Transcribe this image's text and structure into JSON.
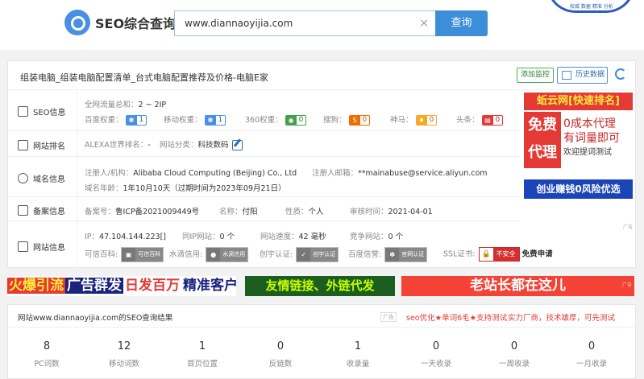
{
  "header": {
    "logo_text": "SEO综合查询",
    "search_value": "www.diannaoyijia.com",
    "search_button": "查询",
    "clear_glyph": "×",
    "corner_text": "权威 数据 精准 分析"
  },
  "site": {
    "title": "组装电脑_组装电脑配置清单_台式电脑配置推荐及价格-电脑E家",
    "monitor_button": "添加监控",
    "history_button": "历史数据"
  },
  "seo": {
    "label": "SEO信息",
    "traffic_label": "全网流量总和：",
    "traffic_value": "2 ~ 2IP",
    "weights": [
      {
        "label": "百度权重：",
        "value": "1",
        "color": "#4a90e2"
      },
      {
        "label": "移动权重：",
        "value": "1",
        "color": "#4a90e2"
      },
      {
        "label": "360权重：",
        "value": "0",
        "color": "#43a047"
      },
      {
        "label": "搜狗：",
        "value": "0",
        "color": "#ef6c00"
      },
      {
        "label": "神马：",
        "value": "0",
        "color": "#f9a825"
      },
      {
        "label": "头条：",
        "value": "0",
        "color": "#e53935"
      }
    ]
  },
  "rank": {
    "label": "网站排名",
    "alexa_label": "ALEXA世界排名：",
    "alexa_value": "-",
    "category_label": "网站分类：",
    "category_value": "科技数码"
  },
  "domain": {
    "label": "域名信息",
    "registrant_label": "注册人/机构：",
    "registrant_value": "Alibaba Cloud Computing (Beijing) Co., Ltd",
    "email_label": "注册人邮箱：",
    "email_value": "**mainabuse@service.aliyun.com",
    "age_label": "域名年龄：",
    "age_value": "1年10月10天（过期时间为2023年09月21日）"
  },
  "icp": {
    "label": "备案信息",
    "number_label": "备案号：",
    "number_value": "鲁ICP备2021009449号",
    "name_label": "名称：",
    "name_value": "付阳",
    "nature_label": "性质：",
    "nature_value": "个人",
    "date_label": "审核时间：",
    "date_value": "2021-04-01"
  },
  "siteinfo": {
    "label": "网站信息",
    "ip_label": "IP：",
    "ip_value": "47.104.144.223[]",
    "sameip_label": "同IP网站：",
    "sameip_value": "0 个",
    "speed_label": "网站速度：",
    "speed_value": "42 毫秒",
    "competitor_label": "竞争网站：",
    "competitor_value": "0 个",
    "certs": [
      {
        "label": "可信百科:",
        "badge": "可信百科"
      },
      {
        "label": "水滴信用:",
        "badge": "水滴信用"
      },
      {
        "label": "创宇认证:",
        "badge": "创宇认证"
      },
      {
        "label": "百度信誉:",
        "badge": "官网认证"
      }
    ],
    "ssl_label": "SSL证书:",
    "ssl_badge": "不安全",
    "ssl_apply": "免费申请"
  },
  "ad_right": {
    "top": "蚯云网[快速排名]",
    "red_block": "免费代理",
    "line1": "0成本代理",
    "line2": "有词量即可",
    "line3": "欢迎提词测试",
    "blue": "创业赚钱0风险优选",
    "tag": "广告"
  },
  "banners": {
    "b1_parts": [
      "火爆引流",
      "广告群发",
      "日发百万",
      "精准客户"
    ],
    "b2": "友情链接、外链代发",
    "b3": "老站长都在这儿",
    "b3_tag": "广告"
  },
  "result": {
    "title": "网站www.diannaoyijia.com的SEO查询结果",
    "ad_tag": "广告",
    "link1": "seo优化★单词6毛★支持测试",
    "link2": "实力厂商，技术雄厚，可先测试",
    "stats": [
      {
        "num": "8",
        "label": "PC词数"
      },
      {
        "num": "12",
        "label": "移动词数"
      },
      {
        "num": "1",
        "label": "首页位置"
      },
      {
        "num": "0",
        "label": "反链数"
      },
      {
        "num": "1",
        "label": "收录量"
      },
      {
        "num": "0",
        "label": "一天收录"
      },
      {
        "num": "0",
        "label": "一周收录"
      },
      {
        "num": "0",
        "label": "一月收录"
      }
    ]
  }
}
